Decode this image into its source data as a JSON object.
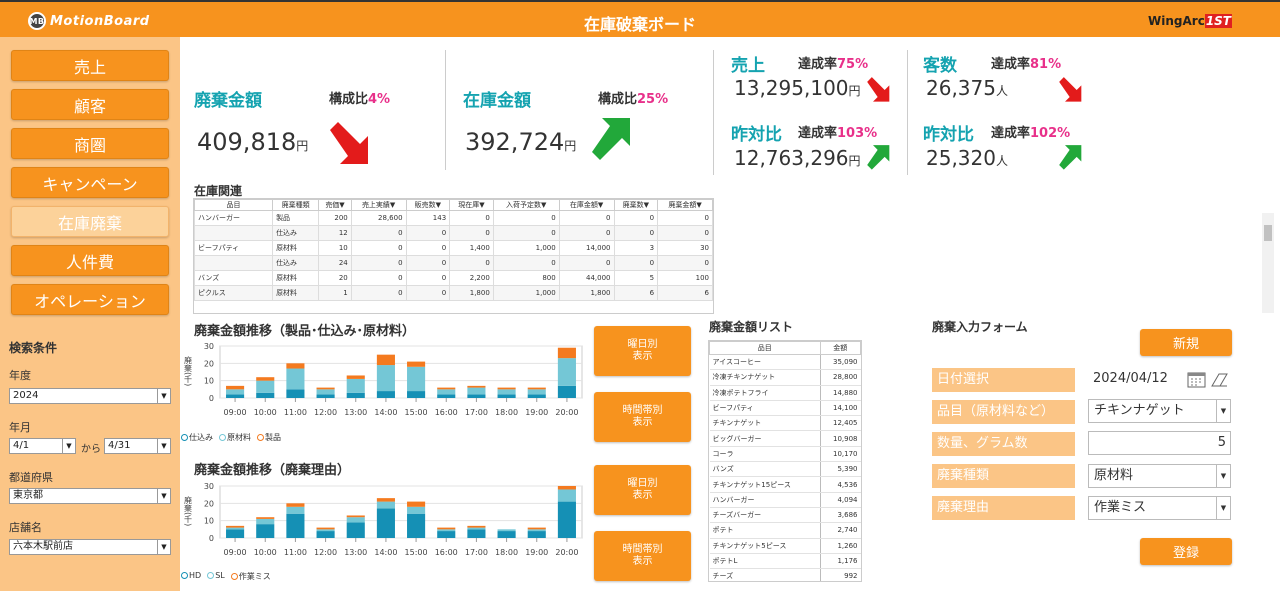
{
  "header": {
    "logo_text": "MotionBoard",
    "logo_badge": "MB",
    "title": "在庫破棄ボード",
    "brand": "WingArc",
    "brand_suffix": "1ST"
  },
  "sidebar": {
    "items": [
      "売上",
      "顧客",
      "商圏",
      "キャンペーン",
      "在庫廃棄",
      "人件費",
      "オペレーション"
    ],
    "active": "在庫廃棄"
  },
  "search": {
    "title": "検索条件",
    "year_label": "年度",
    "year_value": "2024",
    "month_label": "年月",
    "month_from": "4/1",
    "month_sep": "から",
    "month_to": "4/31",
    "pref_label": "都道府県",
    "pref_value": "東京都",
    "store_label": "店舗名",
    "store_value": "六本木駅前店"
  },
  "kpi": {
    "waste": {
      "label": "廃棄金額",
      "ratio_label": "構成比",
      "ratio": "4%",
      "value": "409,818",
      "unit": "円",
      "trend": "down"
    },
    "stock": {
      "label": "在庫金額",
      "ratio_label": "構成比",
      "ratio": "25%",
      "value": "392,724",
      "unit": "円",
      "trend": "up"
    },
    "sales": {
      "label": "売上",
      "rate_label": "達成率",
      "rate": "75%",
      "value": "13,295,100",
      "unit": "円",
      "trend": "down"
    },
    "sales_yoy": {
      "label": "昨対比",
      "rate_label": "達成率",
      "rate": "103%",
      "value": "12,763,296",
      "unit": "円",
      "trend": "up"
    },
    "customers": {
      "label": "客数",
      "rate_label": "達成率",
      "rate": "81%",
      "value": "26,375",
      "unit": "人",
      "trend": "down"
    },
    "customers_yoy": {
      "label": "昨対比",
      "rate_label": "達成率",
      "rate": "102%",
      "value": "25,320",
      "unit": "人",
      "trend": "up"
    }
  },
  "inventory": {
    "title": "在庫関連",
    "headers": [
      "品目",
      "廃棄種類",
      "売価▼",
      "売上実績▼",
      "販売数▼",
      "現在庫▼",
      "入荷予定数▼",
      "在庫金額▼",
      "廃棄数▼",
      "廃棄金額▼"
    ],
    "rows": [
      [
        "ハンバーガー",
        "製品",
        "200",
        "28,600",
        "143",
        "0",
        "0",
        "0",
        "0",
        "0"
      ],
      [
        "",
        "仕込み",
        "12",
        "0",
        "0",
        "0",
        "0",
        "0",
        "0",
        "0"
      ],
      [
        "ビーフパティ",
        "原材料",
        "10",
        "0",
        "0",
        "1,400",
        "1,000",
        "14,000",
        "3",
        "30"
      ],
      [
        "",
        "仕込み",
        "24",
        "0",
        "0",
        "0",
        "0",
        "0",
        "0",
        "0"
      ],
      [
        "バンズ",
        "原材料",
        "20",
        "0",
        "0",
        "2,200",
        "800",
        "44,000",
        "5",
        "100"
      ],
      [
        "ピクルス",
        "原材料",
        "1",
        "0",
        "0",
        "1,800",
        "1,000",
        "1,800",
        "6",
        "6"
      ]
    ]
  },
  "chart_data": [
    {
      "type": "bar",
      "title": "廃棄金額推移（製品･仕込み･原材料）",
      "ylabel": "廃棄(千)",
      "categories": [
        "09:00",
        "10:00",
        "11:00",
        "12:00",
        "13:00",
        "14:00",
        "15:00",
        "16:00",
        "17:00",
        "18:00",
        "19:00",
        "20:00"
      ],
      "ylim": [
        0,
        30
      ],
      "yticks": [
        0,
        10,
        20,
        30
      ],
      "stacked": true,
      "series": [
        {
          "name": "仕込み",
          "color": "#1590b5",
          "values": [
            2,
            3,
            5,
            2,
            3,
            4,
            4,
            2,
            2,
            2,
            2,
            7
          ]
        },
        {
          "name": "原材料",
          "color": "#74c7d6",
          "values": [
            3,
            7,
            12,
            3,
            8,
            15,
            14,
            3,
            4,
            3,
            3,
            16
          ]
        },
        {
          "name": "製品",
          "color": "#f47a1f",
          "values": [
            2,
            2,
            3,
            1,
            2,
            6,
            3,
            1,
            1,
            1,
            1,
            6
          ]
        }
      ]
    },
    {
      "type": "bar",
      "title": "廃棄金額推移（廃棄理由）",
      "ylabel": "廃棄(千)",
      "categories": [
        "09:00",
        "10:00",
        "11:00",
        "12:00",
        "13:00",
        "14:00",
        "15:00",
        "16:00",
        "17:00",
        "18:00",
        "19:00",
        "20:00"
      ],
      "ylim": [
        0,
        30
      ],
      "yticks": [
        0,
        10,
        20,
        30
      ],
      "stacked": true,
      "series": [
        {
          "name": "HD",
          "color": "#1590b5",
          "values": [
            5,
            8,
            14,
            4,
            9,
            17,
            14,
            4,
            5,
            4,
            4,
            21
          ]
        },
        {
          "name": "SL",
          "color": "#74c7d6",
          "values": [
            1,
            3,
            4,
            1,
            3,
            4,
            4,
            1,
            1,
            1,
            1,
            7
          ]
        },
        {
          "name": "作業ミス",
          "color": "#f47a1f",
          "values": [
            1,
            1,
            2,
            1,
            1,
            2,
            3,
            1,
            1,
            0,
            1,
            2
          ]
        }
      ]
    }
  ],
  "buttons": {
    "weekday": "曜日別\n表示",
    "timezone": "時間帯別\n表示"
  },
  "loss_list": {
    "title": "廃棄金額リスト",
    "headers": [
      "品目",
      "金額"
    ],
    "rows": [
      [
        "アイスコーヒー",
        "35,090"
      ],
      [
        "冷凍チキンナゲット",
        "28,800"
      ],
      [
        "冷凍ポテトフライ",
        "14,880"
      ],
      [
        "ビーフパティ",
        "14,100"
      ],
      [
        "チキンナゲット",
        "12,405"
      ],
      [
        "ビッグバーガー",
        "10,908"
      ],
      [
        "コーラ",
        "10,170"
      ],
      [
        "バンズ",
        "5,390"
      ],
      [
        "チキンナゲット15ピース",
        "4,536"
      ],
      [
        "ハンバーガー",
        "4,094"
      ],
      [
        "チーズバーガー",
        "3,686"
      ],
      [
        "ポテト",
        "2,740"
      ],
      [
        "チキンナゲット5ピース",
        "1,260"
      ],
      [
        "ポテトL",
        "1,176"
      ],
      [
        "チーズ",
        "992"
      ]
    ]
  },
  "form": {
    "title": "廃棄入力フォーム",
    "new_label": "新規",
    "register_label": "登録",
    "date_label": "日付選択",
    "date_value": "2024/04/12",
    "item_label": "品目（原材料など）",
    "item_value": "チキンナゲット",
    "qty_label": "数量、グラム数",
    "qty_value": "5",
    "type_label": "廃棄種類",
    "type_value": "原材料",
    "reason_label": "廃棄理由",
    "reason_value": "作業ミス"
  }
}
